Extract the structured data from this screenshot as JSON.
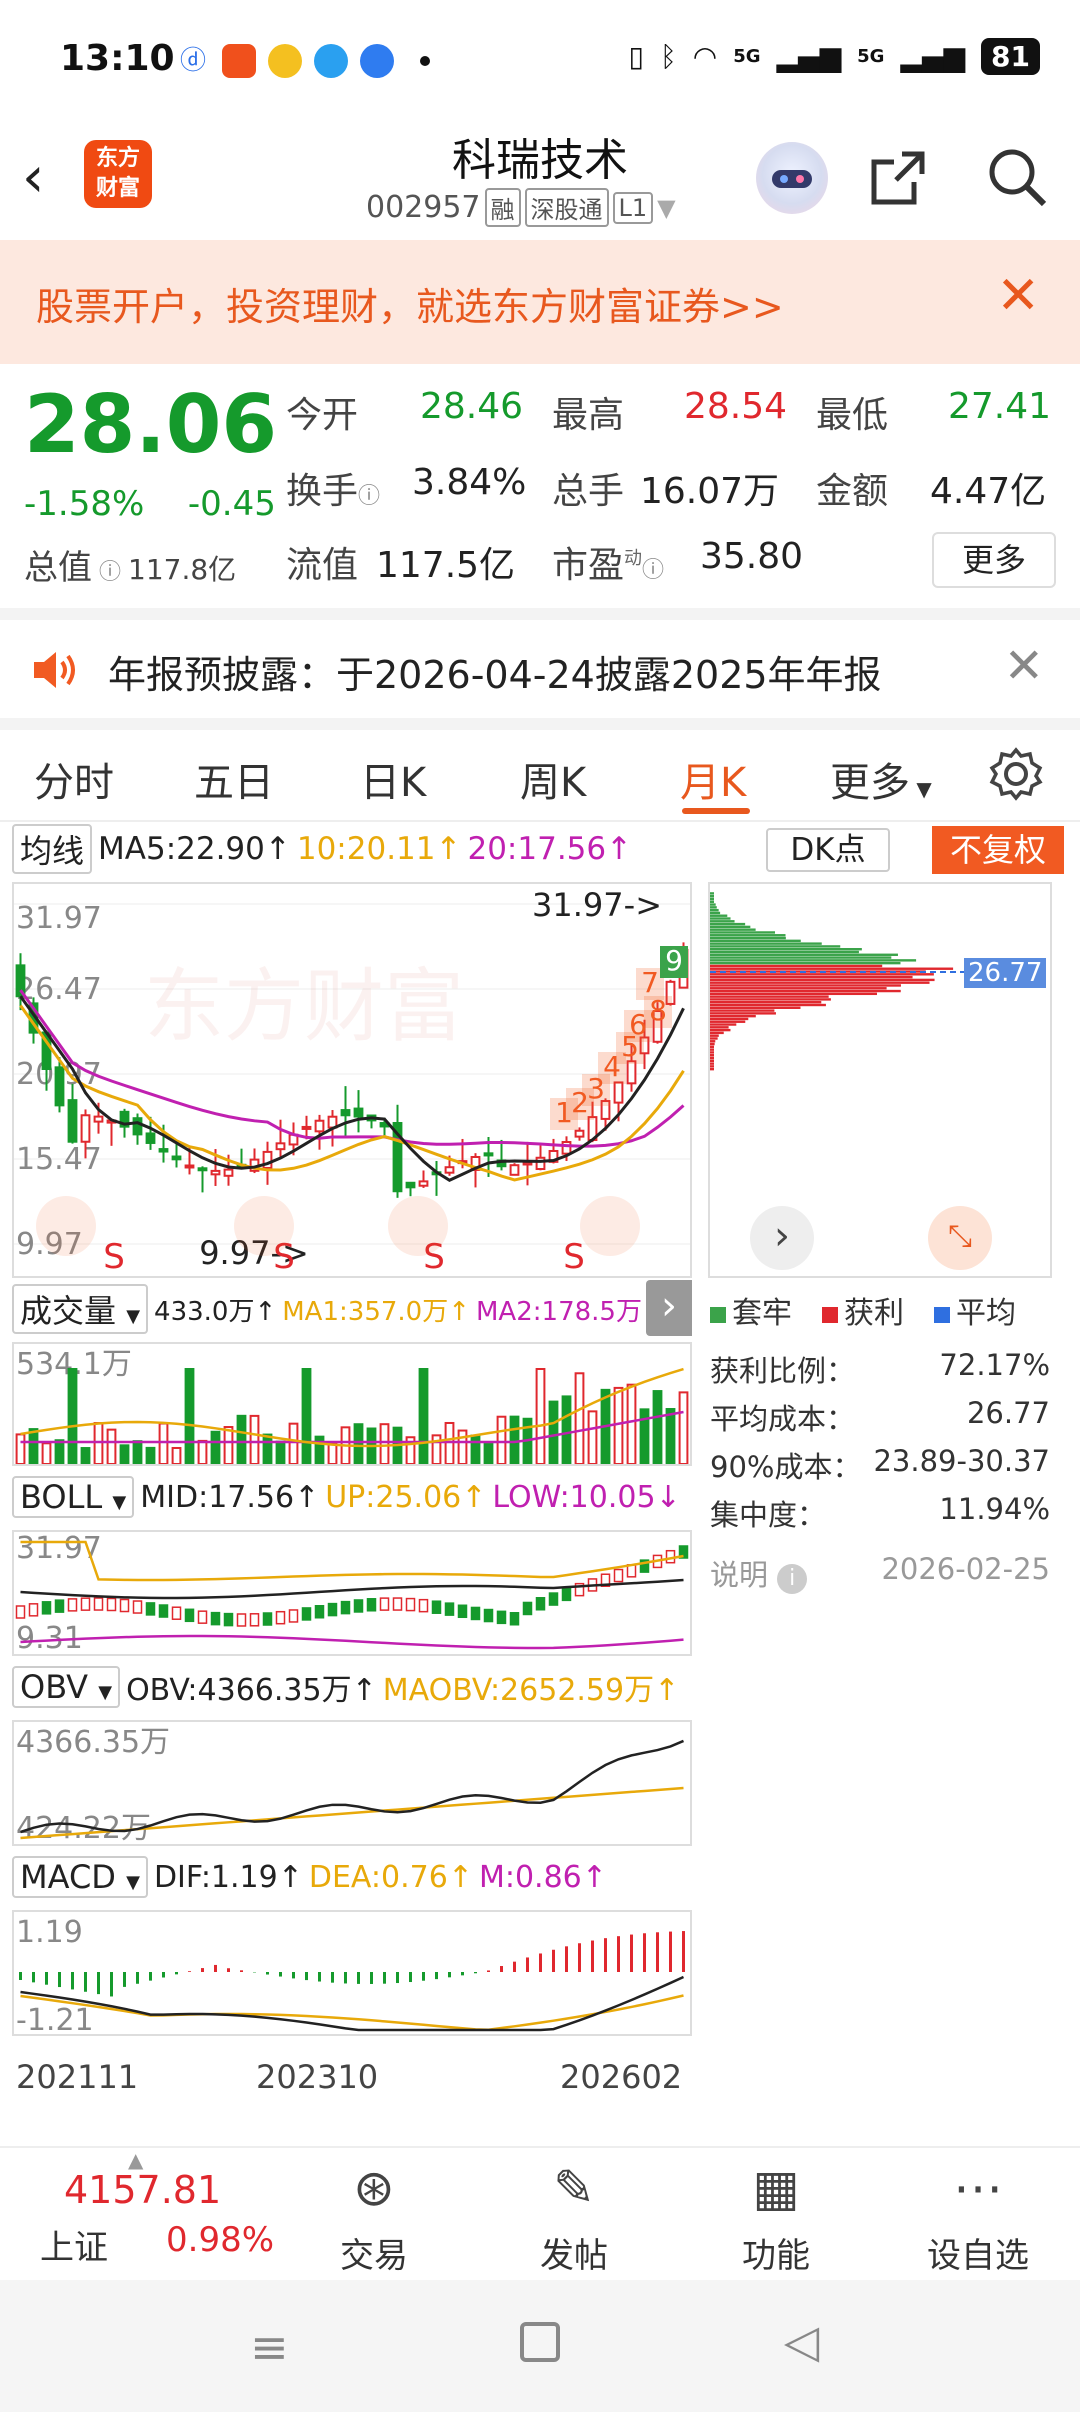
{
  "status": {
    "time": "13:10",
    "battery": "81",
    "signal1": "5G",
    "signal2": "5G"
  },
  "header": {
    "logo_line1": "东方",
    "logo_line2": "财富",
    "stock_name": "科瑞技术",
    "stock_code": "002957",
    "tags": [
      "融",
      "深股通",
      "L1"
    ]
  },
  "banner": {
    "text": "股票开户，投资理财，就选东方财富证券>>"
  },
  "quote": {
    "price": "28.06",
    "change_pct": "-1.58%",
    "change": "-0.45",
    "open_label": "今开",
    "open": "28.46",
    "high_label": "最高",
    "high": "28.54",
    "low_label": "最低",
    "low": "27.41",
    "turnover_label": "换手",
    "turnover": "3.84%",
    "volume_label": "总手",
    "volume": "16.07万",
    "amount_label": "金额",
    "amount": "4.47亿",
    "mktcap_label": "总值",
    "mktcap": "117.8亿",
    "float_label": "流值",
    "float": "117.5亿",
    "pe_label": "市盈",
    "pe_sup": "动",
    "pe": "35.80",
    "more": "更多"
  },
  "notice": {
    "text": "年报预披露：于2026-04-24披露2025年年报"
  },
  "tabs": [
    "分时",
    "五日",
    "日K",
    "周K",
    "月K",
    "更多"
  ],
  "active_tab": "月K",
  "kline": {
    "selector": "均线",
    "ma5": "MA5:22.90↑",
    "ma10": "10:20.11↑",
    "ma20": "20:17.56↑",
    "dk_btn": "DK点",
    "fq_btn": "不复权",
    "y_labels": [
      "31.97",
      "26.47",
      "20.97",
      "15.47",
      "9.97"
    ],
    "max_mark": "31.97->",
    "min_mark": "9.97->",
    "watermark": "东方财富",
    "seq_nums": [
      "1",
      "2",
      "3",
      "4",
      "5",
      "6",
      "7",
      "8",
      "9"
    ],
    "sell_mark": "S"
  },
  "chip": {
    "avg_cost_label": "26.77",
    "legend": [
      "套牢",
      "获利",
      "平均"
    ],
    "stats": [
      {
        "label": "获利比例：",
        "value": "72.17%"
      },
      {
        "label": "平均成本：",
        "value": "26.77"
      },
      {
        "label": "90%成本：",
        "value": "23.89-30.37"
      },
      {
        "label": "集中度：",
        "value": "11.94%"
      }
    ],
    "note_label": "说明",
    "note_date": "2026-02-25"
  },
  "volume": {
    "selector": "成交量",
    "vol": "433.0万↑",
    "ma1": "MA1:357.0万↑",
    "ma2": "MA2:178.5万↑",
    "y_top": "534.1万"
  },
  "boll": {
    "selector": "BOLL",
    "mid": "MID:17.56↑",
    "up": "UP:25.06↑",
    "low": "LOW:10.05↓",
    "y_top": "31.97",
    "y_bot": "9.31"
  },
  "obv": {
    "selector": "OBV",
    "obv": "OBV:4366.35万↑",
    "maobv": "MAOBV:2652.59万↑",
    "y_top": "4366.35万",
    "y_bot": "424.22万"
  },
  "macd": {
    "selector": "MACD",
    "dif": "DIF:1.19↑",
    "dea": "DEA:0.76↑",
    "m": "M:0.86↑",
    "y_top": "1.19",
    "y_bot": "-1.21"
  },
  "x_axis": [
    "202111",
    "202310",
    "202602"
  ],
  "bottom_nav": {
    "index_value": "4157.81",
    "index_name": "上证",
    "index_pct": "0.98%",
    "items": [
      "交易",
      "发帖",
      "功能",
      "设自选"
    ]
  },
  "colors": {
    "up": "#e0282e",
    "down": "#159a2c",
    "accent": "#e8581e"
  }
}
